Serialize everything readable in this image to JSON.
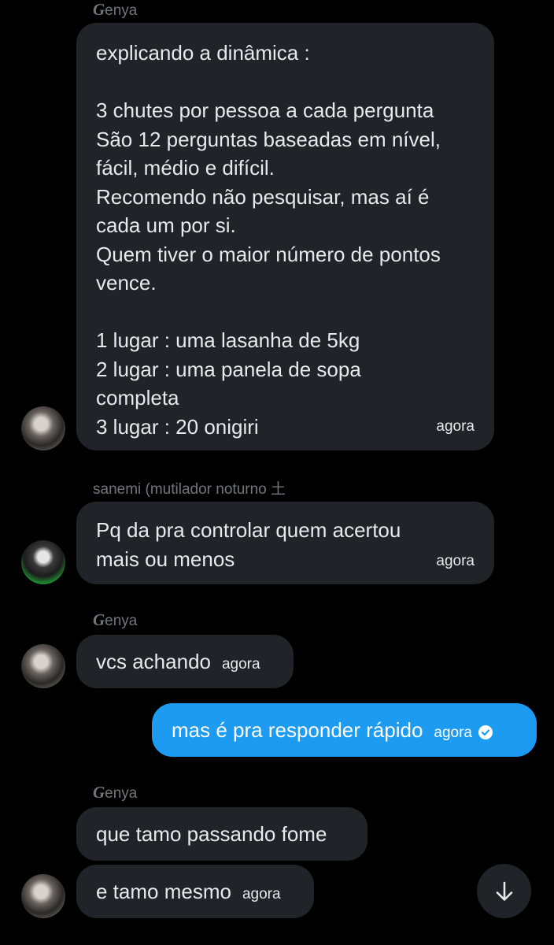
{
  "messages": [
    {
      "sender": "Genya",
      "text": "explicando a dinâmica :\n\n3 chutes por pessoa a cada pergunta\nSão 12 perguntas baseadas em nível,\nfácil, médio e difícil.\nRecomendo não pesquisar, mas aí é\ncada um por si.\nQuem tiver o maior número de pontos\nvence.\n\n1 lugar : uma lasanha de 5kg\n2 lugar : uma panela de sopa\ncompleta\n3 lugar : 20 onigiri",
      "time": "agora"
    },
    {
      "sender": "sanemi (mutilador noturno 土",
      "text": "Pq da pra controlar quem acertou\nmais ou menos",
      "time": "agora"
    },
    {
      "sender": "Genya",
      "text": "vcs achando",
      "time": "agora"
    },
    {
      "sender": "",
      "text": "mas é pra responder rápido",
      "time": "agora",
      "status_icon": "check-circle-icon",
      "accent": "#1d9bf0"
    },
    {
      "sender": "Genya",
      "text": "que tamo passando fome",
      "time": ""
    },
    {
      "sender": "",
      "text": "e tamo mesmo",
      "time": "agora"
    }
  ],
  "sender_genya_initial": "G",
  "sender_genya_rest": "enya",
  "scroll_down_icon": "arrow-down-icon",
  "colors": {
    "background": "#000000",
    "bubble": "#202327",
    "accent": "#1d9bf0",
    "muted": "#71767b"
  }
}
